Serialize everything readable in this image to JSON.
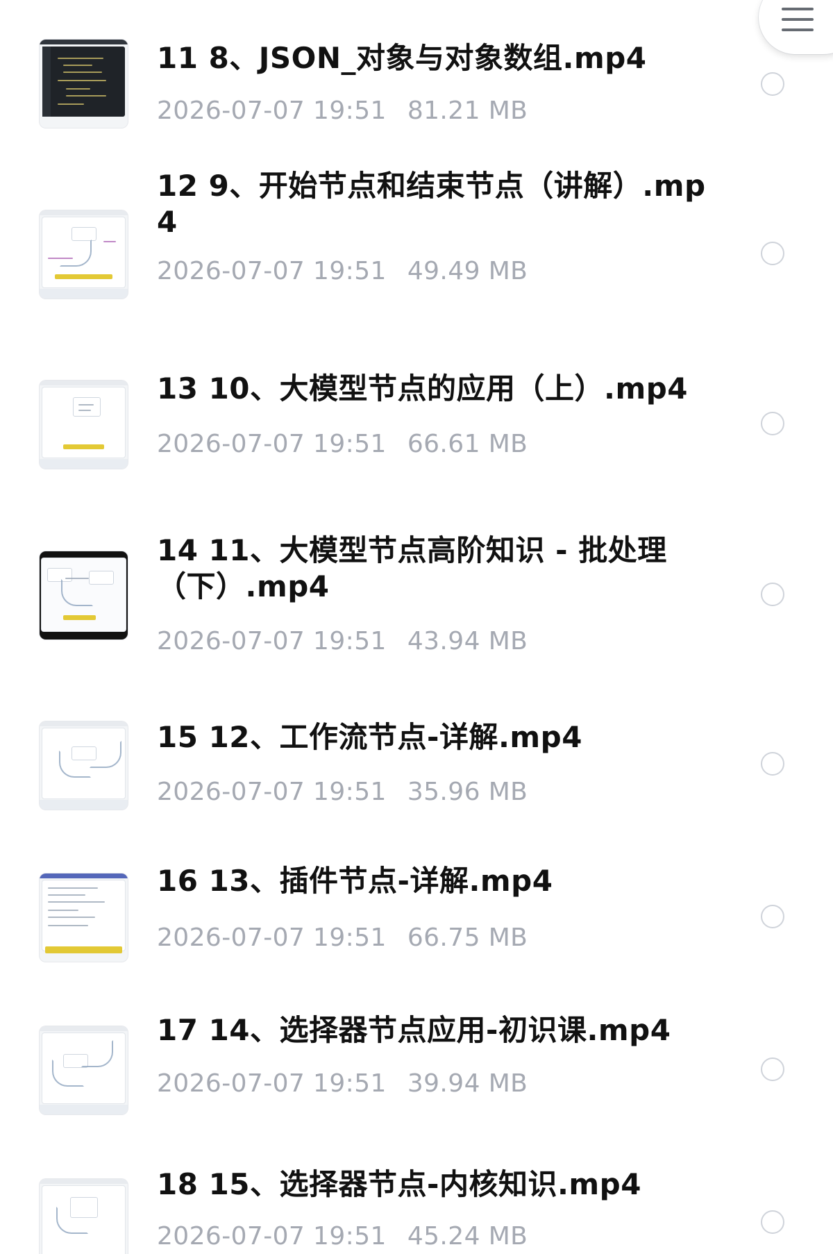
{
  "files": [
    {
      "title": "11 8、JSON_对象与对象数组.mp4",
      "date": "2026-07-07 19:51",
      "size": "81.21 MB"
    },
    {
      "title": "12 9、开始节点和结束节点（讲解）.mp4",
      "date": "2026-07-07 19:51",
      "size": "49.49 MB"
    },
    {
      "title": "13 10、大模型节点的应用（上）.mp4",
      "date": "2026-07-07 19:51",
      "size": "66.61 MB"
    },
    {
      "title": "14 11、大模型节点高阶知识 - 批处理（下）.mp4",
      "date": "2026-07-07 19:51",
      "size": "43.94 MB"
    },
    {
      "title": "15 12、工作流节点-详解.mp4",
      "date": "2026-07-07 19:51",
      "size": "35.96 MB"
    },
    {
      "title": "16 13、插件节点-详解.mp4",
      "date": "2026-07-07 19:51",
      "size": "66.75 MB"
    },
    {
      "title": "17 14、选择器节点应用-初识课.mp4",
      "date": "2026-07-07 19:51",
      "size": "39.94 MB"
    },
    {
      "title": "18 15、选择器节点-内核知识.mp4",
      "date": "2026-07-07 19:51",
      "size": "45.24 MB"
    }
  ],
  "icons": {
    "menu": "menu-icon",
    "selection": "radio-unchecked-icon",
    "thumbnail": "video-thumbnail"
  },
  "colors": {
    "title": "#111111",
    "meta": "#a5a9b2",
    "radio": "#cfd3da",
    "menu": "#666b72"
  }
}
